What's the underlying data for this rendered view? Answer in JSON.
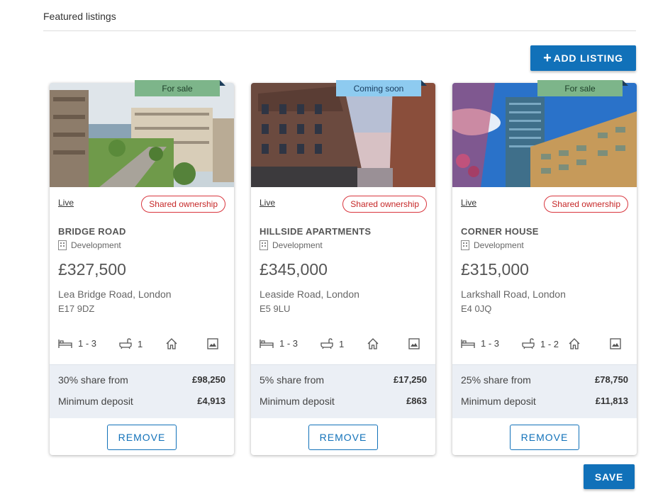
{
  "section": {
    "title": "Featured listings"
  },
  "actions": {
    "add_label": "ADD LISTING",
    "add_icon": "plus-icon",
    "save_label": "SAVE"
  },
  "colors": {
    "primary": "#1171b9",
    "for_sale": "#7db58a",
    "coming_soon": "#8ecbf0",
    "badge_red": "#d9363e",
    "shares_bg": "#ebeff5"
  },
  "listings": [
    {
      "status": "For sale",
      "live": "Live",
      "badge": "Shared ownership",
      "name": "BRIDGE ROAD",
      "type": "Development",
      "price": "£327,500",
      "address_line1": "Lea Bridge Road, London",
      "address_line2": "E17 9DZ",
      "beds": "1 - 3",
      "baths": "1",
      "share_label": "30% share from",
      "share_value": "£98,250",
      "deposit_label": "Minimum deposit",
      "deposit_value": "£4,913",
      "remove_label": "REMOVE"
    },
    {
      "status": "Coming soon",
      "live": "Live",
      "badge": "Shared ownership",
      "name": "HILLSIDE APARTMENTS",
      "type": "Development",
      "price": "£345,000",
      "address_line1": "Leaside Road, London",
      "address_line2": "E5 9LU",
      "beds": "1 - 3",
      "baths": "1",
      "share_label": "5% share from",
      "share_value": "£17,250",
      "deposit_label": "Minimum deposit",
      "deposit_value": "£863",
      "remove_label": "REMOVE"
    },
    {
      "status": "For sale",
      "live": "Live",
      "badge": "Shared ownership",
      "name": "CORNER HOUSE",
      "type": "Development",
      "price": "£315,000",
      "address_line1": "Larkshall Road, London",
      "address_line2": "E4 0JQ",
      "beds": "1 - 3",
      "baths": "1 - 2",
      "share_label": "25% share from",
      "share_value": "£78,750",
      "deposit_label": "Minimum deposit",
      "deposit_value": "£11,813",
      "remove_label": "REMOVE"
    }
  ]
}
